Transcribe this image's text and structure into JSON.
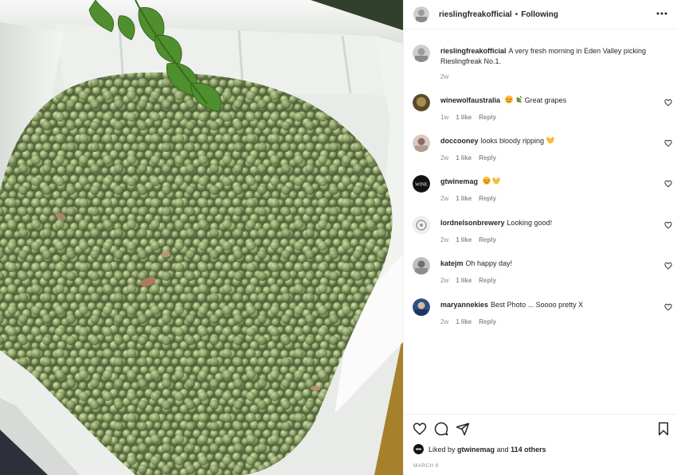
{
  "post": {
    "author": "rieslingfreakofficial",
    "follow_separator": "•",
    "follow_label": "Following",
    "more_icon": "more-horizontal-icon",
    "caption": "A very fresh morning in Eden Valley picking Rieslingfreak No.1.",
    "caption_time": "2w",
    "liked_prefix": "Liked by",
    "liked_user": "gtwinemag",
    "liked_and": "and",
    "liked_others": "114 others",
    "date": "MARCH 8"
  },
  "comments": [
    {
      "user": "winewolfaustralia",
      "text": "Great grapes",
      "emoji": [
        "star-struck-emoji",
        "grapes-emoji"
      ],
      "time": "1w",
      "likes": "1 like",
      "reply": "Reply"
    },
    {
      "user": "doccooney",
      "text": "looks bloody ripping",
      "emoji_after": [
        "raising-hands-emoji"
      ],
      "time": "2w",
      "likes": "1 like",
      "reply": "Reply"
    },
    {
      "user": "gtwinemag",
      "text": "",
      "emoji": [
        "star-struck-emoji",
        "raising-hands-emoji"
      ],
      "time": "2w",
      "likes": "1 like",
      "reply": "Reply",
      "avatar_text": "WINE"
    },
    {
      "user": "lordnelsonbrewery",
      "text": "Looking good!",
      "time": "2w",
      "likes": "1 like",
      "reply": "Reply"
    },
    {
      "user": "katejm",
      "text": "Oh happy day!",
      "time": "2w",
      "likes": "1 like",
      "reply": "Reply"
    },
    {
      "user": "maryannekies",
      "text": "Best Photo ... Soooo pretty X",
      "time": "2w",
      "likes": "1 like",
      "reply": "Reply"
    }
  ],
  "icons": {
    "like": "heart-icon",
    "comment": "comment-icon",
    "share": "paper-plane-icon",
    "save": "bookmark-icon"
  },
  "colors": {
    "text": "#262626",
    "secondary": "#8e8e8e",
    "border": "#efefef",
    "grape": "#9bb071",
    "bin": "#e9ece8"
  }
}
